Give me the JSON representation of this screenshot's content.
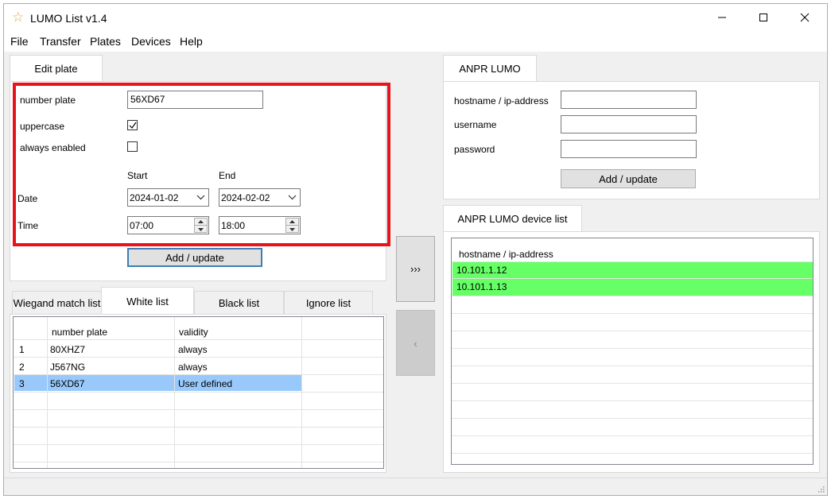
{
  "window": {
    "title": "LUMO List v1.4",
    "icon": "star-icon",
    "icon_color": "#e8a33d"
  },
  "menu": [
    "File",
    "Transfer",
    "Plates",
    "Devices",
    "Help"
  ],
  "edit_plate": {
    "tab": "Edit plate",
    "number_plate_label": "number plate",
    "number_plate_value": "56XD67",
    "uppercase_label": "uppercase",
    "uppercase_checked": true,
    "always_enabled_label": "always enabled",
    "always_enabled_checked": false,
    "start_label": "Start",
    "end_label": "End",
    "date_label": "Date",
    "date_start": "2024-01-02",
    "date_end": "2024-02-02",
    "time_label": "Time",
    "time_start": "07:00",
    "time_end": "18:00",
    "add_update": "Add / update",
    "highlight_color": "#e8141c"
  },
  "list_tabs": {
    "tabs": [
      "Wiegand match list",
      "White list",
      "Black list",
      "Ignore list"
    ],
    "active": "White list",
    "columns": [
      "",
      "number plate",
      "validity"
    ],
    "rows": [
      {
        "index": "1",
        "plate": "80XHZ7",
        "validity": "always"
      },
      {
        "index": "2",
        "plate": "J567NG",
        "validity": "always"
      },
      {
        "index": "3",
        "plate": "56XD67",
        "validity": "User defined"
      }
    ],
    "selected_row": 2,
    "selected_color": "#99c9fb"
  },
  "transfer": {
    "right": "›››",
    "left": "‹"
  },
  "anpr": {
    "tab": "ANPR LUMO",
    "hostname_label": "hostname / ip-address",
    "username_label": "username",
    "password_label": "password",
    "hostname_value": "",
    "username_value": "",
    "password_value": "",
    "add_update": "Add / update"
  },
  "device_list": {
    "tab": "ANPR LUMO device list",
    "column": "hostname / ip-address",
    "rows": [
      "10.101.1.12",
      "10.101.1.13"
    ],
    "row_color": "#66ff66"
  }
}
